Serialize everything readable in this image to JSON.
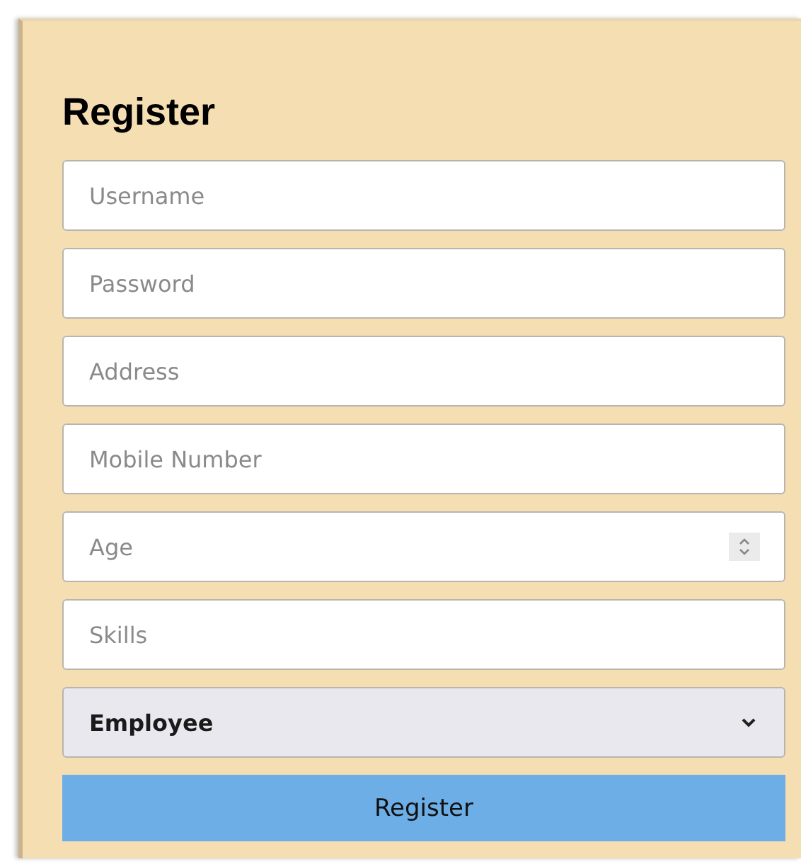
{
  "title": "Register",
  "fields": [
    {
      "kind": "text",
      "placeholder": "Username"
    },
    {
      "kind": "password",
      "placeholder": "Password"
    },
    {
      "kind": "text",
      "placeholder": "Address"
    },
    {
      "kind": "text",
      "placeholder": "Mobile Number"
    },
    {
      "kind": "number",
      "placeholder": "Age"
    },
    {
      "kind": "text",
      "placeholder": "Skills"
    },
    {
      "kind": "select",
      "value": "Employee"
    }
  ],
  "button": "Register"
}
